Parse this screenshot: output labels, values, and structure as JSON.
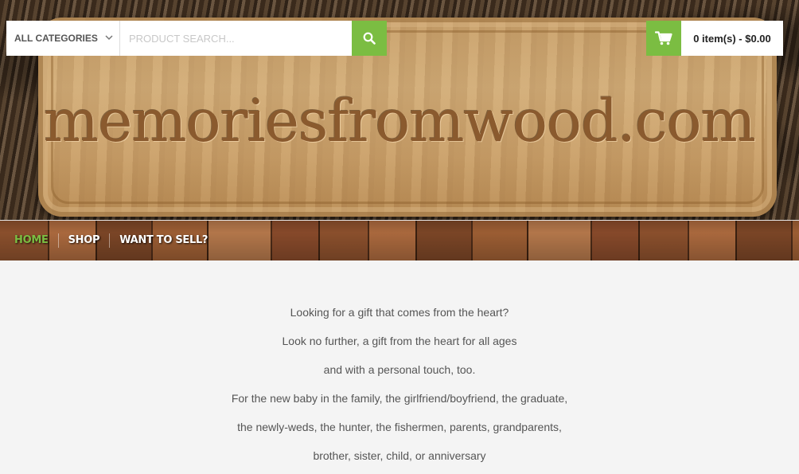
{
  "header": {
    "site_name": "memoriesfromwood.com",
    "category_select": {
      "selected": "ALL CATEGORIES"
    },
    "search": {
      "placeholder": "PRODUCT SEARCH...",
      "value": "",
      "button_icon": "search-icon"
    },
    "cart": {
      "label": "0 item(s) - $0.00",
      "icon": "shopping-cart-icon"
    },
    "accent_color": "#7bbd42"
  },
  "nav": {
    "items": [
      {
        "label": "HOME",
        "active": true
      },
      {
        "label": "SHOP",
        "active": false
      },
      {
        "label": "WANT TO SELL?",
        "active": false
      }
    ]
  },
  "content": {
    "lines": [
      "Looking for a gift that comes from the heart?",
      "Look no further, a gift from the heart for all ages",
      "and with a personal touch, too.",
      "For the new baby in the family, the girlfriend/boyfriend, the graduate,",
      "the newly-weds, the hunter, the fishermen, parents, grandparents,",
      "brother, sister, child, or anniversary"
    ]
  }
}
